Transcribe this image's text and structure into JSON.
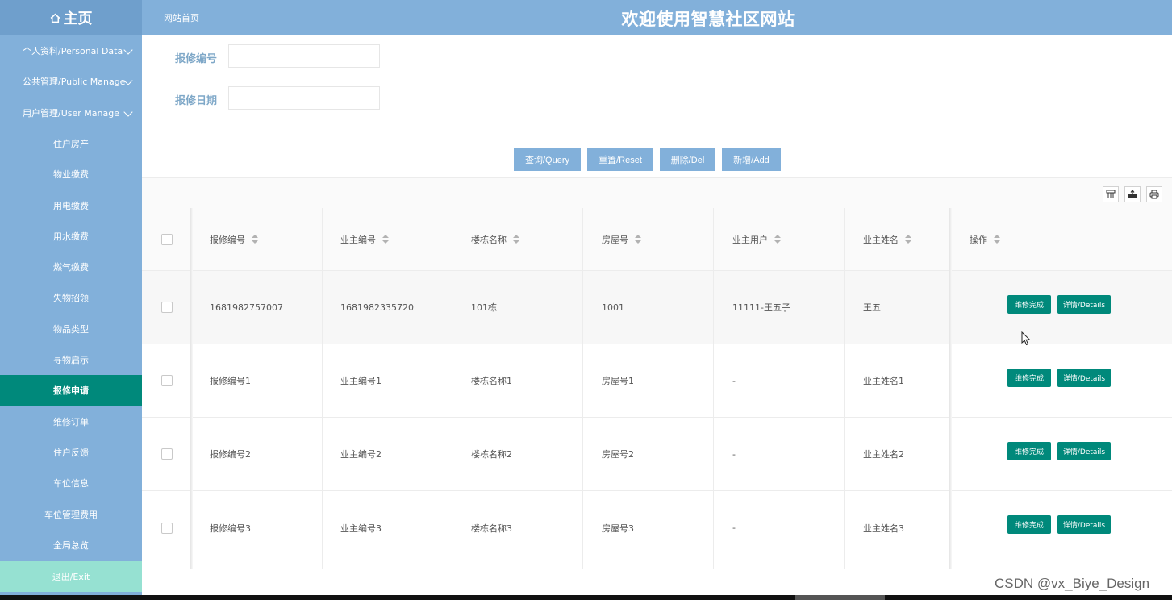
{
  "header": {
    "home_label": "主页",
    "breadcrumb": "网站首页",
    "site_title": "欢迎使用智慧社区网站"
  },
  "sidebar": {
    "items": [
      {
        "label": "个人资料/Personal Data",
        "expandable": true
      },
      {
        "label": "公共管理/Public Manage",
        "expandable": true
      },
      {
        "label": "用户管理/User Manage",
        "expandable": true
      },
      {
        "label": "住户房产"
      },
      {
        "label": "物业缴费"
      },
      {
        "label": "用电缴费"
      },
      {
        "label": "用水缴费"
      },
      {
        "label": "燃气缴费"
      },
      {
        "label": "失物招领"
      },
      {
        "label": "物品类型"
      },
      {
        "label": "寻物启示"
      },
      {
        "label": "报修申请",
        "active": true
      },
      {
        "label": "维修订单"
      },
      {
        "label": "住户反馈"
      },
      {
        "label": "车位信息"
      },
      {
        "label": "车位管理费用"
      },
      {
        "label": "全局总览"
      },
      {
        "label": "退出/Exit"
      }
    ]
  },
  "search": {
    "repair_no_label": "报修编号",
    "repair_no_value": "",
    "repair_date_label": "报修日期",
    "repair_date_value": ""
  },
  "actions": {
    "query": "查询/Query",
    "reset": "重置/Reset",
    "delete": "删除/Del",
    "add": "新增/Add"
  },
  "toolbar_icons": [
    "columns-filter-icon",
    "export-icon",
    "print-icon"
  ],
  "table": {
    "columns": [
      "报修编号",
      "业主编号",
      "楼栋名称",
      "房屋号",
      "业主用户",
      "业主姓名",
      "操作"
    ],
    "rows": [
      {
        "repair_no": "1681982757007",
        "owner_no": "1681982335720",
        "building": "101栋",
        "room": "1001",
        "owner_user": "11111-王五子",
        "owner_name": "王五"
      },
      {
        "repair_no": "报修编号1",
        "owner_no": "业主编号1",
        "building": "楼栋名称1",
        "room": "房屋号1",
        "owner_user": "-",
        "owner_name": "业主姓名1"
      },
      {
        "repair_no": "报修编号2",
        "owner_no": "业主编号2",
        "building": "楼栋名称2",
        "room": "房屋号2",
        "owner_user": "-",
        "owner_name": "业主姓名2"
      },
      {
        "repair_no": "报修编号3",
        "owner_no": "业主编号3",
        "building": "楼栋名称3",
        "room": "房屋号3",
        "owner_user": "-",
        "owner_name": "业主姓名3"
      }
    ],
    "row_actions": {
      "complete": "维修完成",
      "details": "详情/Details"
    }
  },
  "watermark": "CSDN @vx_Biye_Design",
  "colors": {
    "sidebar": "#82b0da",
    "active": "#00897b",
    "exit": "#96e1d2",
    "button": "#82b0da"
  }
}
